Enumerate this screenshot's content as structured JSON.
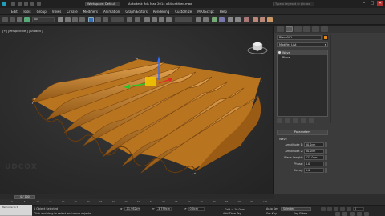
{
  "window": {
    "workspace": "Workspace: Default",
    "title": "Autodesk 3ds Max  2014 x64     untitled.max",
    "search_placeholder": "Type a keyword or phrase",
    "minimize": "–",
    "maximize": "□",
    "close": "✕"
  },
  "menu": [
    "Edit",
    "Tools",
    "Group",
    "Views",
    "Create",
    "Modifiers",
    "Animation",
    "Graph Editors",
    "Rendering",
    "Customize",
    "MAXScript",
    "Help"
  ],
  "toolbar": {
    "selection_filter": "All"
  },
  "viewport": {
    "label": "[+] [Perspective ] [Shaded ]",
    "watermark": "UDCOX",
    "watermark_small": "LB"
  },
  "command_panel": {
    "object_name": "Plane001",
    "object_color": "#e0861e",
    "modifier_list": "Modifier List",
    "stack": [
      "Wave",
      "Plane"
    ],
    "rollout_title": "Parameters",
    "group_label": "Wave",
    "params": [
      {
        "label": "Amplitude 1:",
        "value": "50.0cm"
      },
      {
        "label": "Amplitude 2:",
        "value": "50.0cm"
      },
      {
        "label": "Wave Length:",
        "value": "125.0cm"
      },
      {
        "label": "Phase:",
        "value": "0.0"
      },
      {
        "label": "Decay:",
        "value": "0.0"
      }
    ]
  },
  "timeline": {
    "thumb": "0 / 100",
    "ticks": [
      "0",
      "5",
      "10",
      "15",
      "20",
      "25",
      "30",
      "35",
      "40",
      "45",
      "50",
      "55",
      "60",
      "65",
      "70",
      "75",
      "80",
      "85",
      "90",
      "95",
      "100"
    ]
  },
  "status": {
    "line1": "1 Object Selected",
    "line2": "Click and drag to select and move objects",
    "x_label": "X:",
    "x_value": "-11.962cm",
    "y_label": "Y:",
    "y_value": "-3.759cm",
    "z_label": "Z:",
    "z_value": "0.0cm",
    "grid": "Grid = 10.0cm",
    "add_time_tag": "Add Time Tag",
    "auto_key": "Auto Key",
    "set_key": "Set Key",
    "selected": "Selected",
    "key_filters": "Key Filters...",
    "frame": "0"
  },
  "maxscript": {
    "line1": "Welcome to M",
    "line2": ""
  },
  "colors": {
    "accent": "#e0861e",
    "viewport_bg": "#2c2c2c",
    "panel_bg": "#3b3b3b"
  }
}
